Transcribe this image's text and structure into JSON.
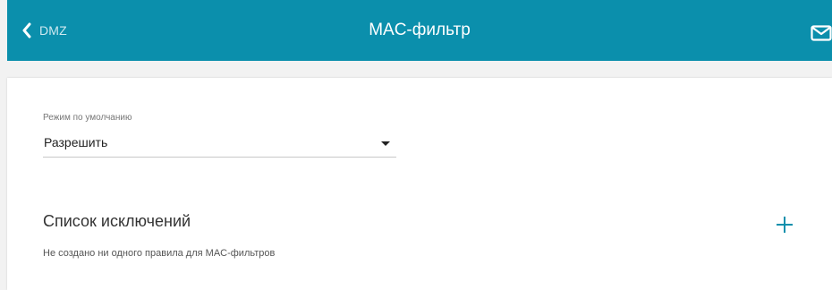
{
  "header": {
    "back_label": "DMZ",
    "title": "MAC-фильтр",
    "bg_color": "#0b8fac"
  },
  "default_mode": {
    "label": "Режим по умолчанию",
    "value": "Разрешить"
  },
  "exceptions": {
    "title": "Список исключений",
    "empty_text": "Не создано ни одного правила для MAC-фильтров",
    "accent_color": "#0b8fac"
  },
  "icons": {
    "back": "chevron-left-icon",
    "notifications": "mail-icon",
    "add": "plus-icon"
  }
}
